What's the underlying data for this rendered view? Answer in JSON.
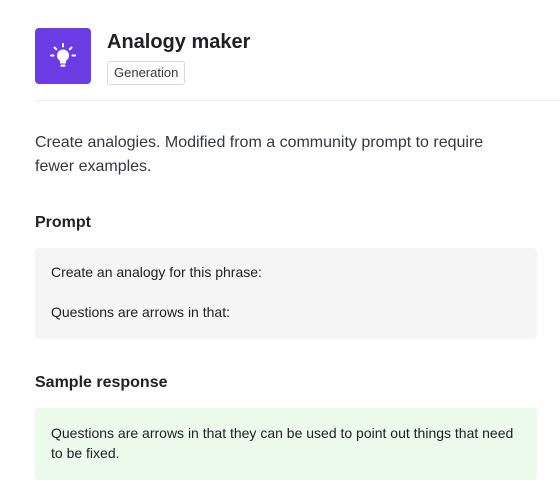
{
  "app": {
    "title": "Analogy maker",
    "tag": "Generation",
    "icon": "lightbulb-icon",
    "accent_color": "#6b3ce4"
  },
  "description": "Create analogies. Modified from a community prompt to require fewer examples.",
  "prompt": {
    "heading": "Prompt",
    "line1": "Create an analogy for this phrase:",
    "line2": "Questions are arrows in that:"
  },
  "sample_response": {
    "heading": "Sample response",
    "text": "Questions are arrows in that they can be used to point out things that need to be fixed."
  }
}
